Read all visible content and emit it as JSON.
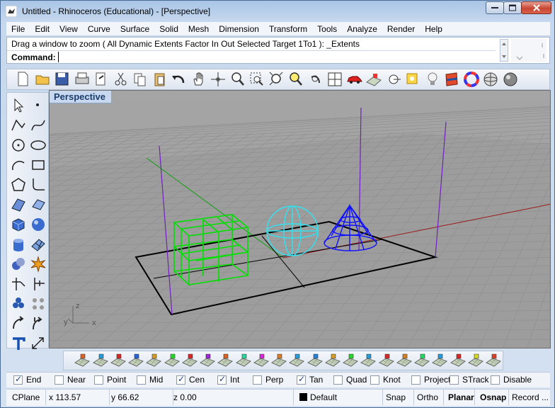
{
  "window": {
    "title": "Untitled - Rhinoceros (Educational) - [Perspective]"
  },
  "menu": [
    "File",
    "Edit",
    "View",
    "Curve",
    "Surface",
    "Solid",
    "Mesh",
    "Dimension",
    "Transform",
    "Tools",
    "Analyze",
    "Render",
    "Help"
  ],
  "command": {
    "history": "Drag a window to zoom ( All  Dynamic  Extents  Factor  In  Out  Selected  Target  1To1 ): _Extents",
    "label": "Command:",
    "value": ""
  },
  "standard_toolbar": [
    "new-file-icon",
    "open-file-icon",
    "save-icon",
    "print-icon",
    "import-icon",
    "cut-icon",
    "copy-icon",
    "paste-icon",
    "undo-icon",
    "pan-hand-icon",
    "rotate-view-icon",
    "zoom-icon",
    "zoom-window-icon",
    "zoom-extents-icon",
    "zoom-selected-icon",
    "undo-view-icon",
    "four-viewports-icon",
    "car-render-icon",
    "grid-icon",
    "cplane-icon",
    "sun-icon",
    "light-bulb-icon",
    "material-icon",
    "color-wheel-icon",
    "sphere-render-icon",
    "sphere-shaded-icon"
  ],
  "viewport": {
    "label": "Perspective",
    "axis_z": "z",
    "axis_y": "y",
    "axis_x": "x"
  },
  "left_toolbar": [
    "select-arrow-icon",
    "point-icon",
    "polyline-icon",
    "curve-icon",
    "circle-icon",
    "ellipse-icon",
    "arc-icon",
    "rectangle-icon",
    "polygon-icon",
    "fillet-curve-icon",
    "surface-corner-icon",
    "extrude-surface-icon",
    "box-icon",
    "sphere-icon",
    "cylinder-icon",
    "mesh-icon",
    "boolean-icon",
    "explode-icon",
    "trim-icon",
    "split-icon",
    "group-icon",
    "array-icon",
    "move-icon",
    "rotate-icon",
    "text-icon",
    "dimension-icon"
  ],
  "bottom_toolbar_count": 24,
  "osnaps": [
    {
      "label": "End",
      "checked": true
    },
    {
      "label": "Near",
      "checked": false
    },
    {
      "label": "Point",
      "checked": false
    },
    {
      "label": "Mid",
      "checked": false
    },
    {
      "label": "Cen",
      "checked": true
    },
    {
      "label": "Int",
      "checked": true
    },
    {
      "label": "Perp",
      "checked": false
    },
    {
      "label": "Tan",
      "checked": true
    },
    {
      "label": "Quad",
      "checked": false
    },
    {
      "label": "Knot",
      "checked": false
    },
    {
      "label": "Project",
      "checked": false
    },
    {
      "label": "STrack",
      "checked": false
    },
    {
      "label": "Disable",
      "checked": false
    }
  ],
  "status": {
    "cplane": "CPlane",
    "x": "x 113.57",
    "y": "y 66.62",
    "z": "z 0.00",
    "layer": "Default",
    "snap": "Snap",
    "ortho": "Ortho",
    "planar": "Planar",
    "osnap": "Osnap",
    "record": "Record ..."
  },
  "colors": {
    "viewport_bg": "#a0a0a0",
    "box": "#00e000",
    "sphere": "#33e0ee",
    "cone": "#1010ff",
    "axis_x": "#9a1818",
    "axis_y": "#10a010",
    "vertical_lines": "#7020c0"
  }
}
